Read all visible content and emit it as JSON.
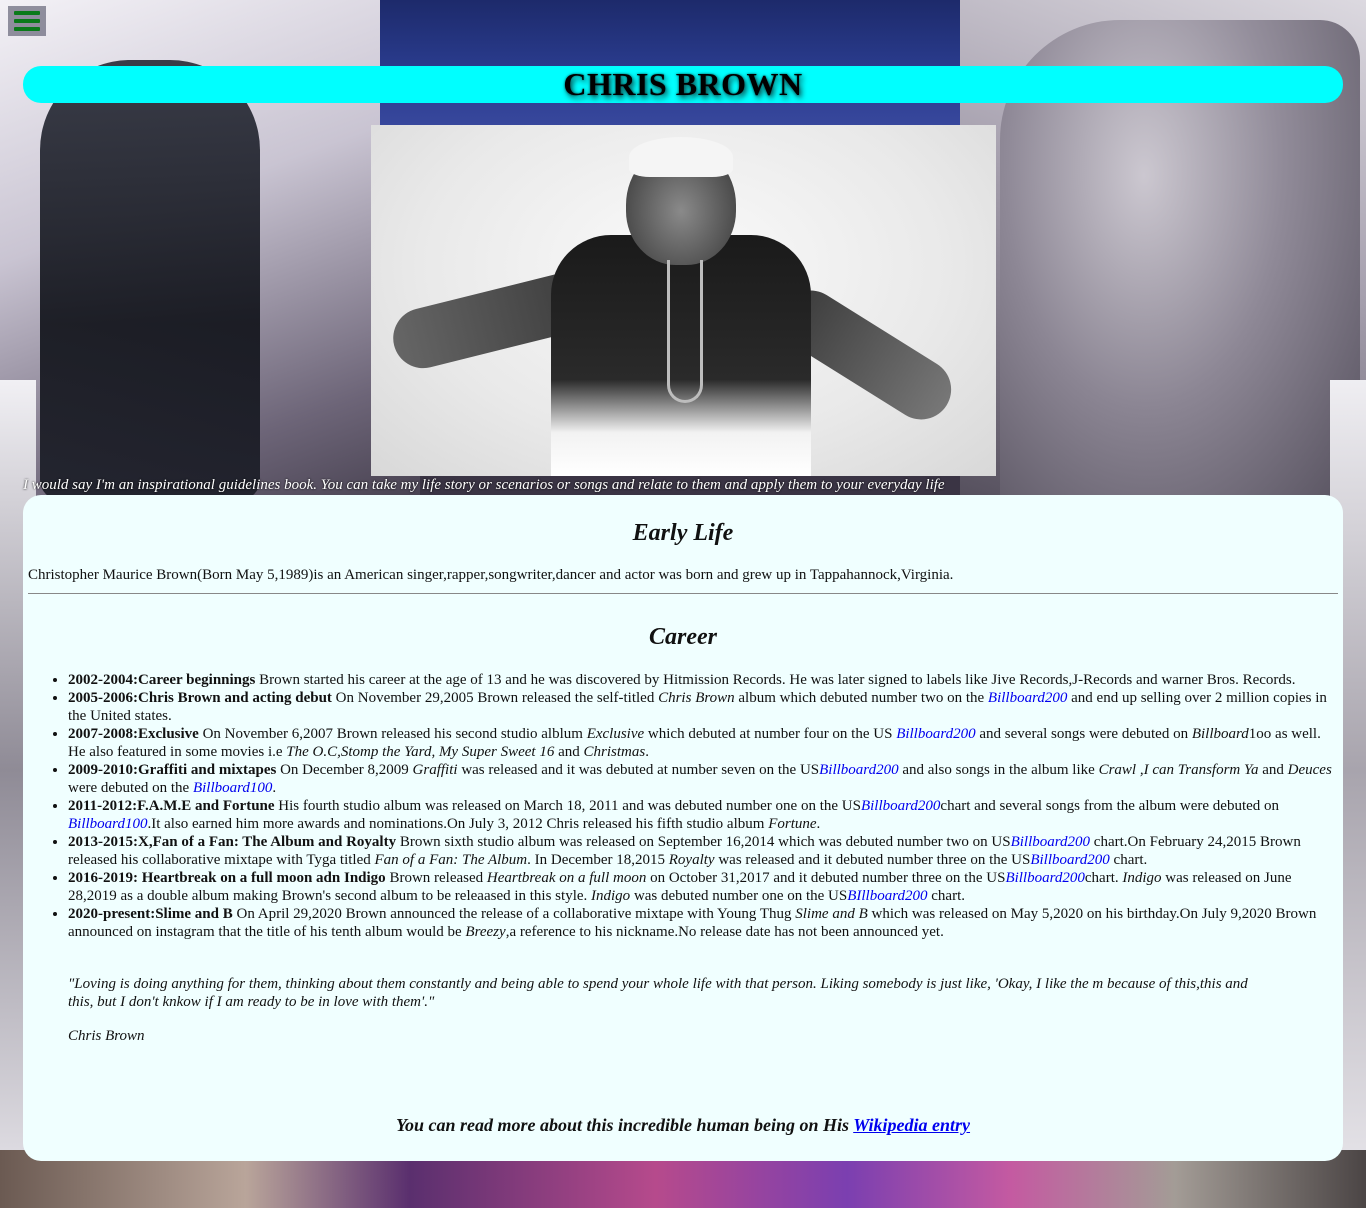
{
  "menu": {
    "icon": "hamburger-menu-icon"
  },
  "header": {
    "title": "CHRIS BROWN"
  },
  "colors": {
    "title_bar": "#00ffff",
    "card_bg": "#f0ffff",
    "link": "#0000ee",
    "menu_icon": "#0a7a1a"
  },
  "hero": {
    "image": "portrait-photo"
  },
  "tagline": "I would say I'm an inspirational guidelines book. You can take my life story or scenarios or songs and relate to them and apply them to your everyday life",
  "early_life": {
    "heading": "Early Life",
    "text": "Christopher Maurice Brown(Born May 5,1989)is an American singer,rapper,songwriter,dancer and actor was born and grew up in Tappahannock,Virginia."
  },
  "career": {
    "heading": "Career",
    "items": [
      {
        "title": "2002-2004:Career beginnings",
        "parts": [
          " Brown started his career at the age of 13 and he was discovered by Hitmission Records. He was later signed to labels like Jive Records,J-Records and warner Bros. Records."
        ]
      },
      {
        "title": "2005-2006:Chris Brown and acting debut",
        "p1": " On November 29,2005 Brown released the self-titled ",
        "i1": "Chris Brown",
        "p2": " album which debuted number two on the ",
        "link1": "Billboard200",
        "p3": " and end up selling over 2 million copies in the United states."
      },
      {
        "title": "2007-2008:Exclusive",
        "p1": " On November 6,2007 Brown released his second studio alblum ",
        "i1": "Exclusive",
        "p2": " which debuted at number four on the US ",
        "link1": "Billboard200",
        "p3": " and several songs were debuted on ",
        "i2": "Billboard",
        "p4": "1oo as well. He also featured in some movies i.e ",
        "i3": "The O.C,Stomp the Yard, My Super Sweet 16",
        "p5": " and ",
        "i4": "Christmas",
        "p6": "."
      },
      {
        "title": "2009-2010:Graffiti and mixtapes",
        "p1": " On December 8,2009 ",
        "i1": "Graffiti",
        "p2": " was released and it was debuted at number seven on the US",
        "link1": "Billboard200",
        "p3": " and also songs in the album like ",
        "i2": "Crawl ,I can Transform Ya",
        "p4": " and ",
        "i3": "Deuces",
        "p5": " were debuted on the ",
        "link2": "Billboard100",
        "p6": "."
      },
      {
        "title": "2011-2012:F.A.M.E and Fortune",
        "p1": " His fourth studio album was released on March 18, 2011 and was debuted number one on the US",
        "link1": "Billboard200",
        "p2": "chart and several songs from the album were debuted on ",
        "link2": "Billboard100",
        "p3": ".It also earned him more awards and nominations.On July 3, 2012 Chris released his fifth studio album ",
        "i1": "Fortune",
        "p4": "."
      },
      {
        "title": "2013-2015:X,Fan of a Fan: The Album and Royalty",
        "p1": " Brown sixth studio album was released on September 16,2014 which was debuted number two on US",
        "link1": "Billboard200",
        "p2": " chart.On February 24,2015 Brown released his collaborative mixtape with Tyga titled ",
        "i1": "Fan of a Fan: The Album",
        "p3": ". In December 18,2015 ",
        "i2": "Royalty",
        "p4": " was released and it debuted number three on the US",
        "link2": "Billboard200",
        "p5": " chart."
      },
      {
        "title": "2016-2019: Heartbreak on a full moon adn Indigo",
        "p1": " Brown released ",
        "i1": "Heartbreak on a full moon",
        "p2": " on October 31,2017 and it debuted number three on the US",
        "link1": "Billboard200",
        "p3": "chart. ",
        "i2": "Indigo",
        "p4": " was released on June 28,2019 as a double album making Brown's second album to be releaased in this style. ",
        "i3": "Indigo",
        "p5": " was debuted number one on the US",
        "link2": "BIllboard200",
        "p6": " chart."
      },
      {
        "title": "2020-present:Slime and B",
        "p1": " On April 29,2020 Brown announced the release of a collaborative mixtape with Young Thug ",
        "i1": "Slime and B",
        "p2": " which was released on May 5,2020 on his birthday.On July 9,2020 Brown announced on instagram that the title of his tenth album would be ",
        "i2": "Breezy",
        "p3": ",a reference to his nickname.No release date has not been announced yet."
      }
    ]
  },
  "quote": {
    "text": "\"Loving is doing anything for them, thinking about them constantly and being able to spend your whole life with that person. Liking somebody is just like, 'Okay, I like the m because of this,this and this, but I don't knkow if I am ready to be in love with them'.\"",
    "author": "Chris Brown"
  },
  "footer": {
    "text": "You can read more about this incredible human being on His ",
    "link": "Wikipedia entry"
  }
}
